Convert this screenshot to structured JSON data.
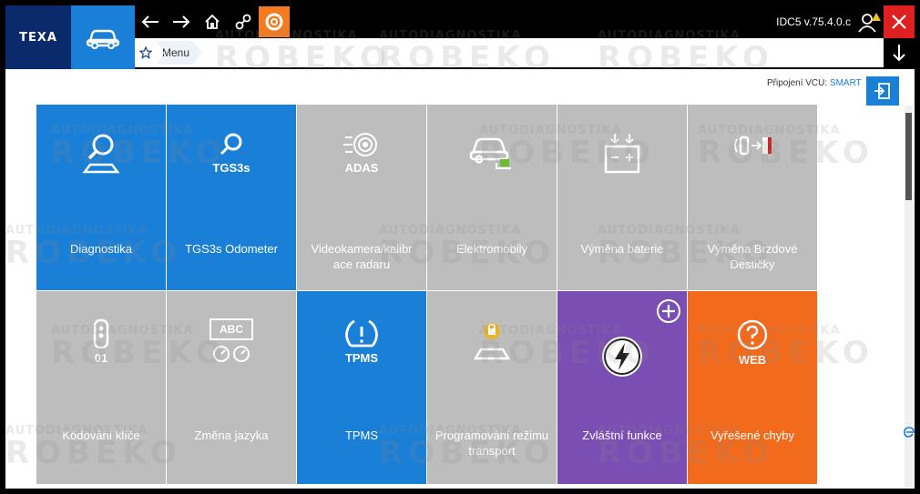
{
  "brand": {
    "logo": "TEXA"
  },
  "toolbar": {
    "nav_icons": [
      "arrow-left-icon",
      "arrow-right-icon",
      "home-icon",
      "link-icon",
      "help-lifebuoy-icon"
    ],
    "version": "IDC5 v.75.4.0.c"
  },
  "breadcrumb": {
    "items": [
      "Menu"
    ]
  },
  "connection": {
    "label": "Připojení VCU:",
    "value": "SMART"
  },
  "tiles": [
    {
      "label": "Diagnostika",
      "icon": "diagnostics-search-icon",
      "color": "#1a7fd6"
    },
    {
      "label": "TGS3s Odometer",
      "sub": "TGS3s",
      "icon": "tgs3s-odometer-icon",
      "color": "#1a7fd6"
    },
    {
      "label": "Videokamera/kalibr ace radaru",
      "sub": "ADAS",
      "icon": "adas-radar-icon",
      "color": "#bdbdbd"
    },
    {
      "label": "Elektromobily",
      "icon": "electric-car-icon",
      "color": "#bdbdbd"
    },
    {
      "label": "Výměna baterie",
      "icon": "battery-icon",
      "color": "#bdbdbd"
    },
    {
      "label": "Výměna Brzdové Destičky",
      "icon": "brake-pad-icon",
      "color": "#bdbdbd"
    },
    {
      "label": "Kódování klíče",
      "sub": "01",
      "icon": "key-fob-icon",
      "color": "#bdbdbd"
    },
    {
      "label": "Změna jazyka",
      "sub": "ABC",
      "icon": "language-icon",
      "color": "#bdbdbd"
    },
    {
      "label": "TPMS",
      "sub": "TPMS",
      "icon": "tpms-tire-icon",
      "color": "#1a7fd6"
    },
    {
      "label": "Programování režimu transport",
      "icon": "transport-mode-icon",
      "color": "#bdbdbd"
    },
    {
      "label": "Zvláštní funkce",
      "icon": "lightning-icon",
      "color": "#7a4eb3"
    },
    {
      "label": "Vyřešené chyby",
      "sub": "WEB",
      "icon": "web-help-icon",
      "color": "#f26a1c"
    }
  ],
  "watermark": {
    "line1": "AUTODIAGNOSTIKA",
    "line2": "ROBEKO"
  }
}
